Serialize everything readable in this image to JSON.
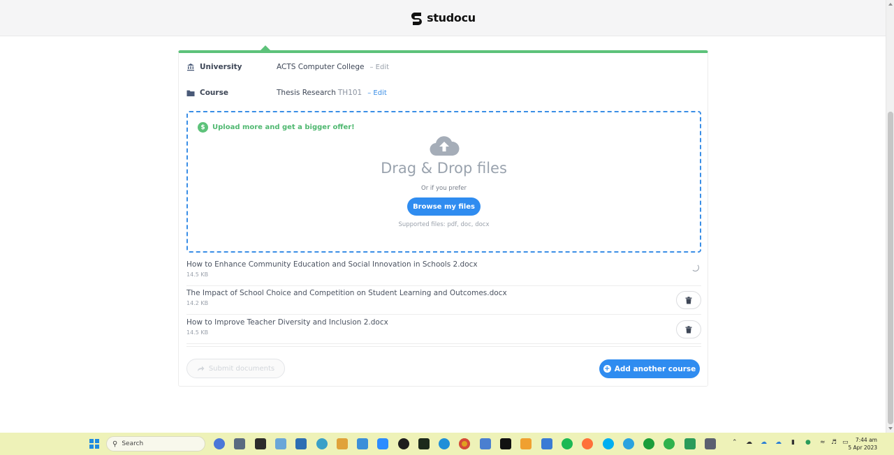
{
  "header": {
    "logo_text": "studocu"
  },
  "upload": {
    "university": {
      "label": "University",
      "value": "ACTS Computer College",
      "edit": "– Edit"
    },
    "course": {
      "label": "Course",
      "value": "Thesis Research",
      "code": "TH101",
      "edit": "– Edit"
    },
    "dropzone": {
      "promo": "Upload more and get a bigger offer!",
      "promo_badge": "$",
      "title": "Drag & Drop files",
      "or_text": "Or if you prefer",
      "browse_label": "Browse my files",
      "supported": "Supported files: pdf, doc, docx"
    },
    "files": [
      {
        "name": "How to Enhance Community Education and Social Innovation in Schools 2.docx",
        "size": "14.5 KB",
        "status": "uploading"
      },
      {
        "name": "The Impact of School Choice and Competition on Student Learning and Outcomes.docx",
        "size": "14.2 KB",
        "status": "done"
      },
      {
        "name": "How to Improve Teacher Diversity and Inclusion 2.docx",
        "size": "14.5 KB",
        "status": "done"
      }
    ],
    "submit_label": "Submit documents",
    "add_course_label": "Add another course"
  },
  "taskbar": {
    "search_placeholder": "Search",
    "time": "7:44 am",
    "date": "5 Apr 2023"
  },
  "colors": {
    "accent_green": "#5dc27a",
    "accent_blue": "#2f8cf0"
  }
}
